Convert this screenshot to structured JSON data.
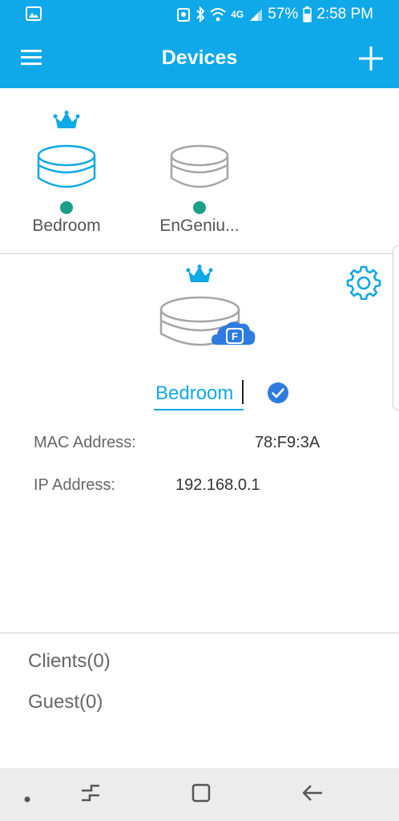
{
  "status_bar": {
    "network": "4G",
    "battery": "57%",
    "time": "2:58 PM"
  },
  "app_bar": {
    "title": "Devices"
  },
  "devices": [
    {
      "label": "Bedroom",
      "active": true,
      "status": "online"
    },
    {
      "label": "EnGeniu...",
      "active": false,
      "status": "online"
    }
  ],
  "detail": {
    "name_value": "Bedroom",
    "badge": "F",
    "mac_label": "MAC Address:",
    "mac_value": "78:F9:3A",
    "ip_label": "IP Address:",
    "ip_value": "192.168.0.1"
  },
  "lists": {
    "clients": "Clients(0)",
    "guest": "Guest(0)"
  },
  "colors": {
    "accent": "#0fa8e8",
    "online": "#1aa086",
    "check": "#2d7be0"
  },
  "icons": {
    "menu": "hamburger-icon",
    "add": "plus-icon",
    "crown": "crown-icon",
    "settings": "gear-icon",
    "confirm": "check-circle-icon",
    "cloud": "cloud-icon"
  }
}
